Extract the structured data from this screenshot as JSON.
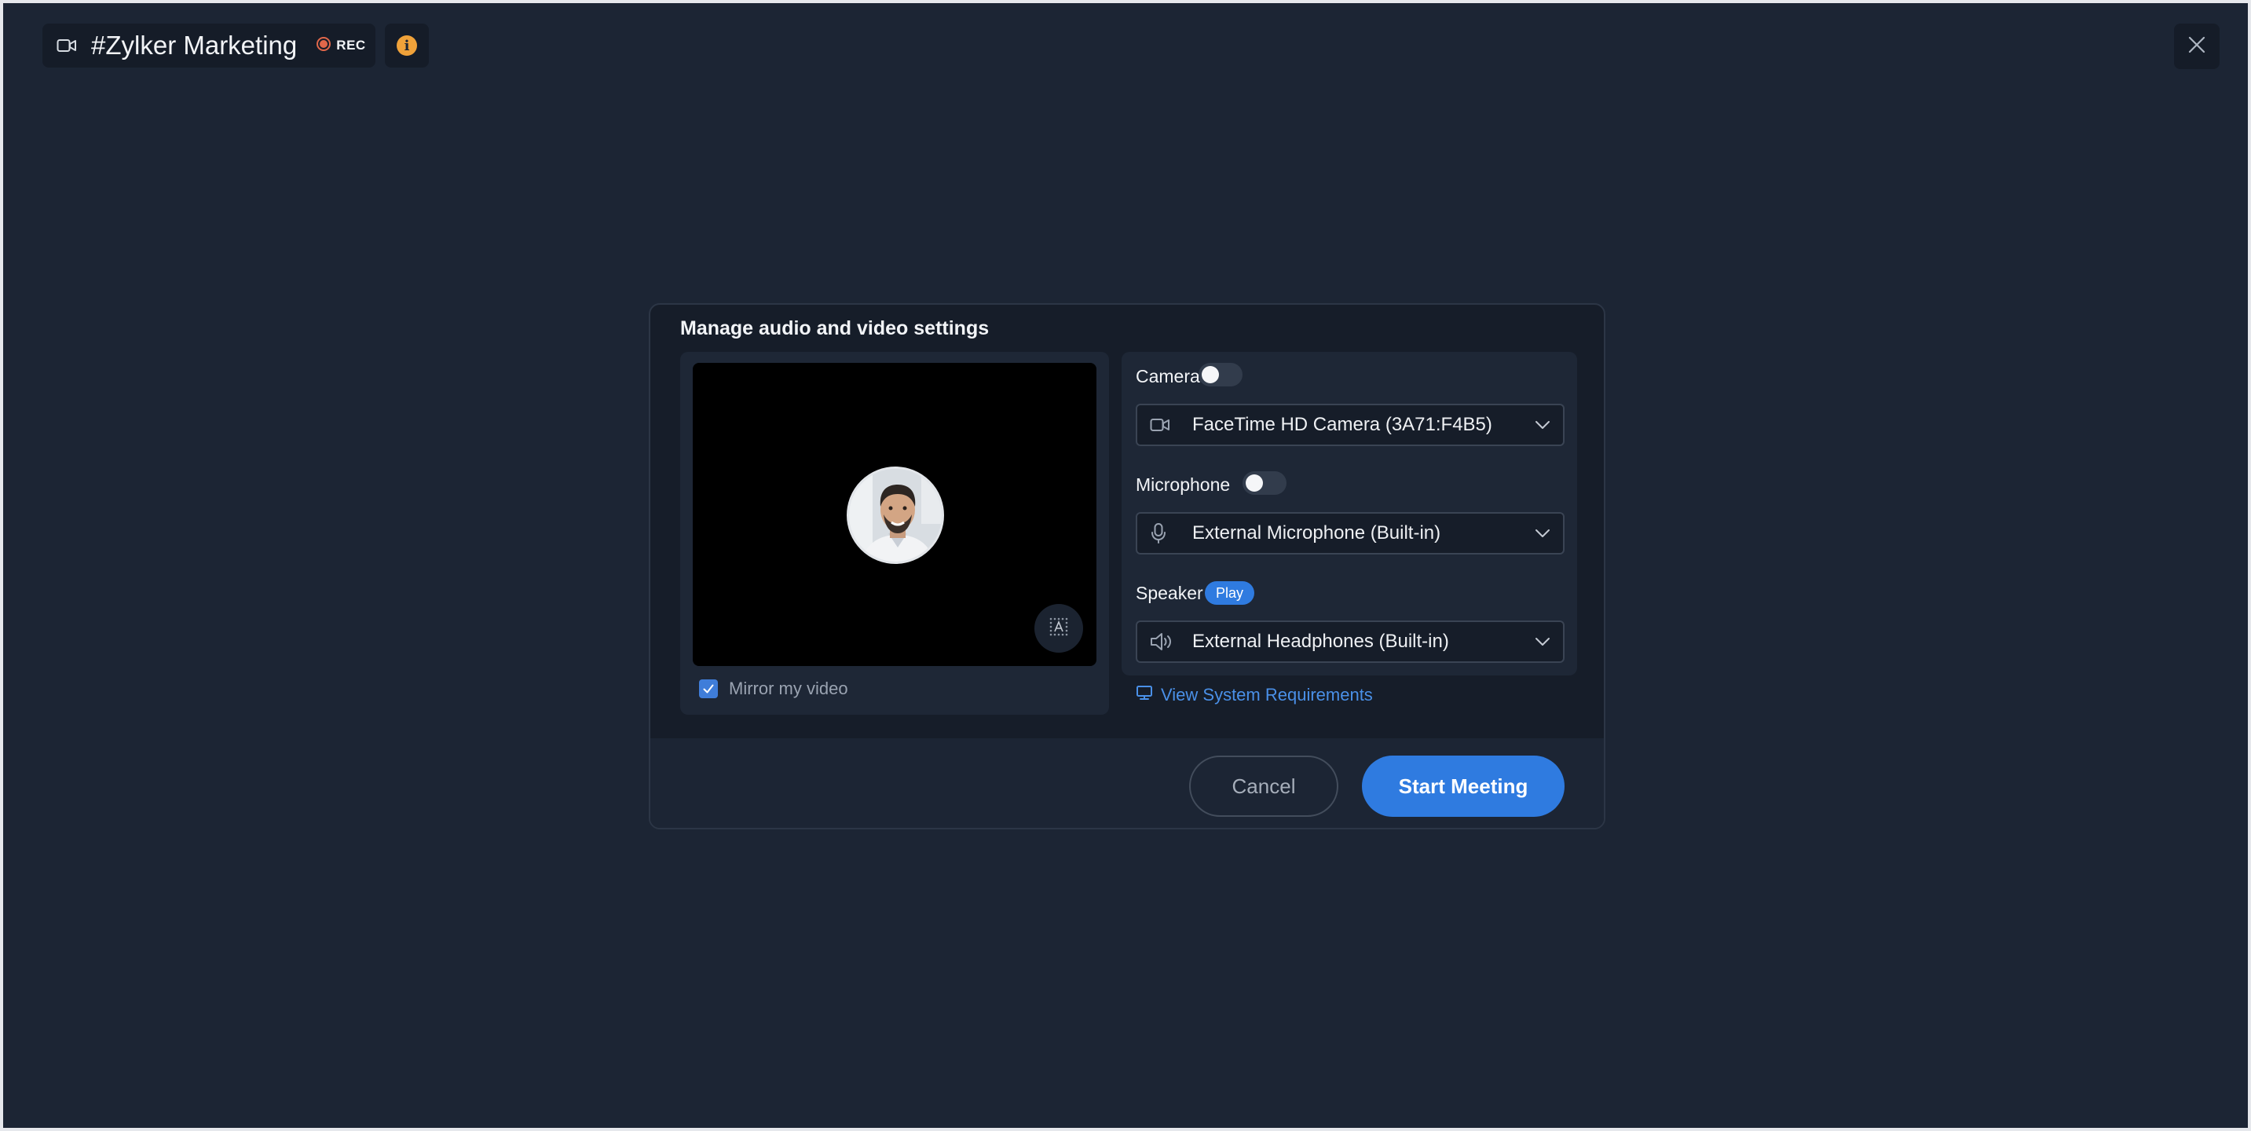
{
  "header": {
    "meeting_title": "#Zylker Marketing",
    "rec_label": "REC",
    "info_icon": "info-icon",
    "close_icon": "close-icon"
  },
  "dialog": {
    "title": "Manage audio and video settings",
    "preview": {
      "mirror_label": "Mirror my video",
      "mirror_checked": true
    },
    "camera": {
      "label": "Camera",
      "enabled": false,
      "device": "FaceTime HD Camera (3A71:F4B5)"
    },
    "microphone": {
      "label": "Microphone",
      "enabled": false,
      "device": "External Microphone (Built-in)"
    },
    "speaker": {
      "label": "Speaker",
      "play_label": "Play",
      "device": "External Headphones (Built-in)"
    },
    "system_requirements_link": "View System Requirements",
    "cancel_label": "Cancel",
    "start_label": "Start Meeting"
  },
  "colors": {
    "background": "#1c2534",
    "dialog": "#161d29",
    "accent": "#2f7be0",
    "rec_dot": "#e0674a",
    "info": "#f0a23a"
  }
}
